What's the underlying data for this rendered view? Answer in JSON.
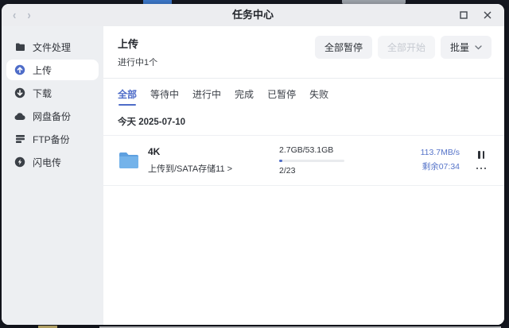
{
  "window": {
    "title": "任务中心"
  },
  "sidebar": {
    "items": [
      {
        "label": "文件处理",
        "icon": "files-icon"
      },
      {
        "label": "上传",
        "icon": "upload-icon"
      },
      {
        "label": "下载",
        "icon": "download-icon"
      },
      {
        "label": "网盘备份",
        "icon": "cloud-backup-icon"
      },
      {
        "label": "FTP备份",
        "icon": "ftp-backup-icon"
      },
      {
        "label": "闪电传",
        "icon": "lightning-transfer-icon"
      }
    ],
    "active_index": 1
  },
  "main": {
    "title": "上传",
    "subtitle": "进行中1个",
    "actions": {
      "pause_all": "全部暂停",
      "start_all": "全部开始",
      "batch": "批量"
    },
    "tabs": [
      {
        "label": "全部"
      },
      {
        "label": "等待中"
      },
      {
        "label": "进行中"
      },
      {
        "label": "完成"
      },
      {
        "label": "已暂停"
      },
      {
        "label": "失败"
      }
    ],
    "active_tab": "全部",
    "date_header": "今天 2025-07-10",
    "task": {
      "name": "4K",
      "destination": "上传到/SATA存储11 >",
      "size_progress": "2.7GB/53.1GB",
      "count_progress": "2/23",
      "progress_percent": 5,
      "speed": "113.7MB/s",
      "remaining": "剩余07:34"
    }
  },
  "colors": {
    "accent_blue": "#4e6cc8",
    "folder_blue": "#74b3ea",
    "sidebar_bg": "#edeff2",
    "titlebar_bg": "#ecedf0"
  }
}
